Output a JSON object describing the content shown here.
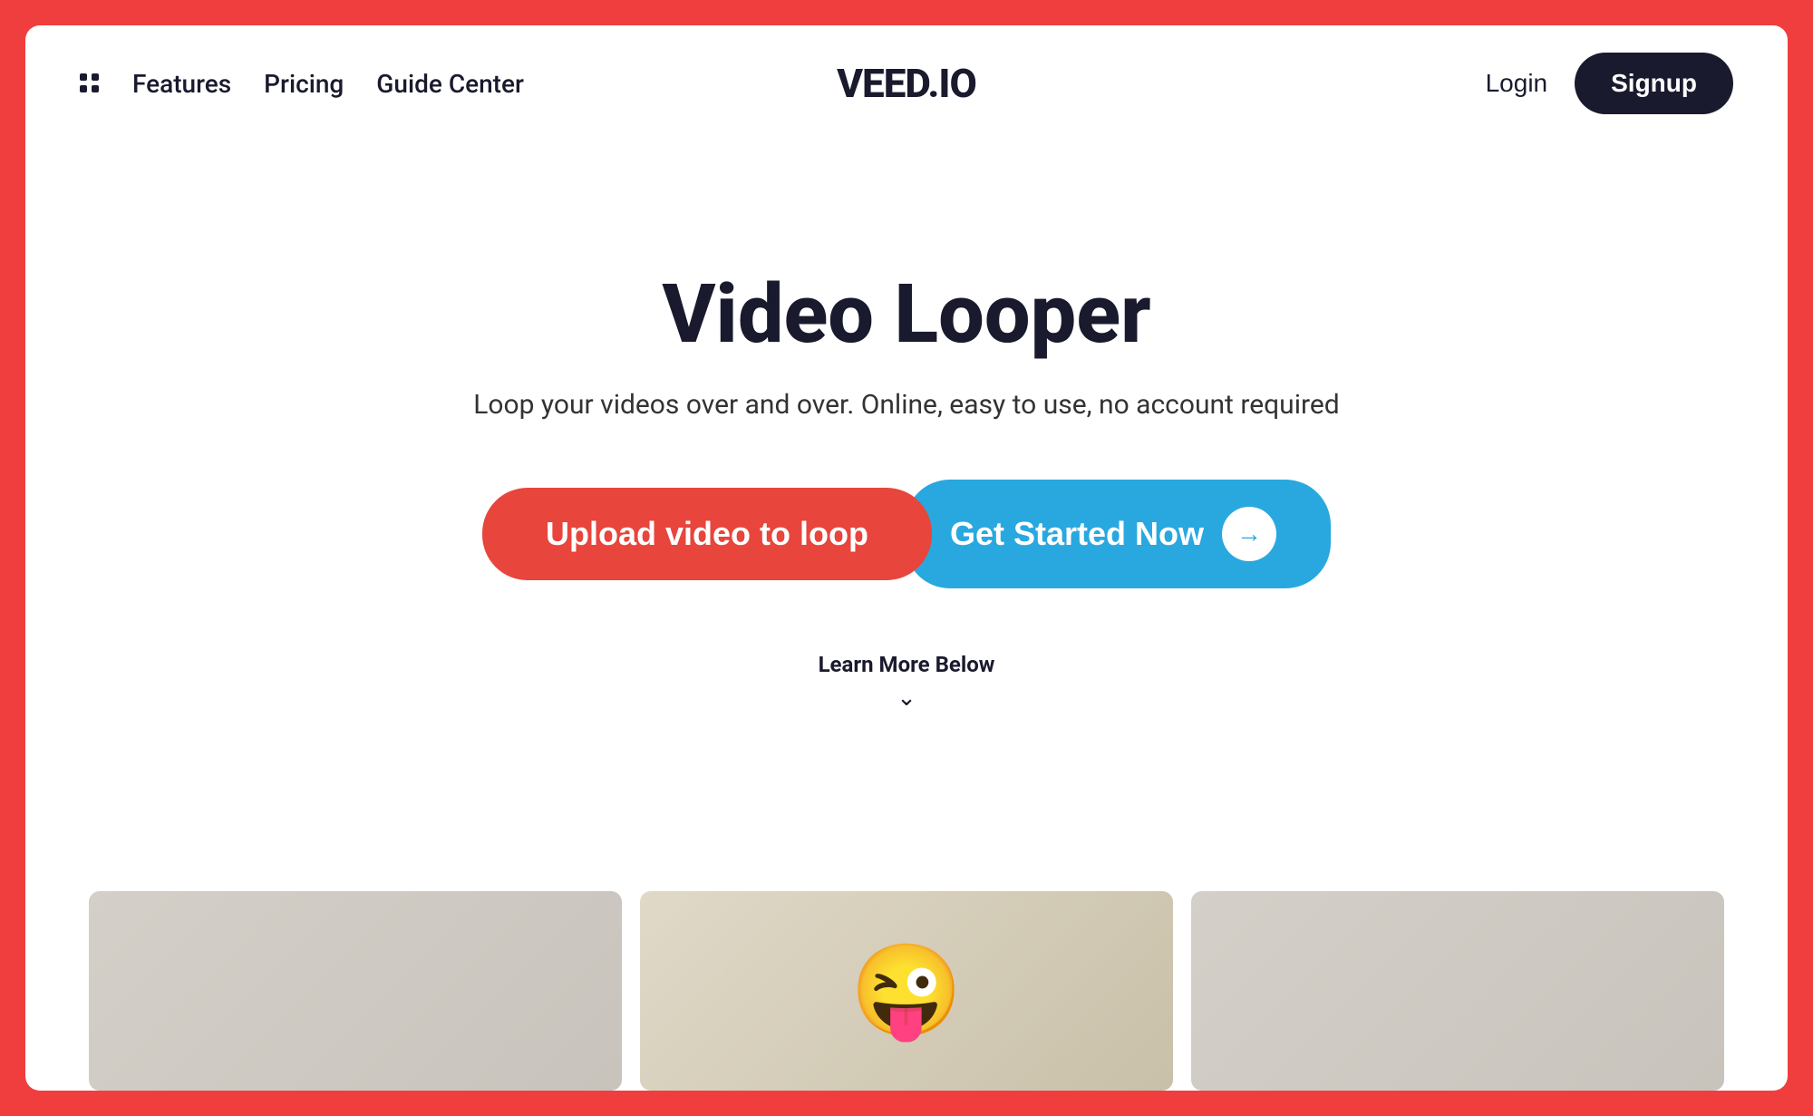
{
  "colors": {
    "outer_bg": "#f03e3e",
    "inner_bg": "#ffffff",
    "dark": "#1a1a2e",
    "red_btn": "#e8453c",
    "blue_btn": "#29a8e0"
  },
  "navbar": {
    "dots_icon": "grid-dots",
    "items": [
      {
        "label": "Features",
        "key": "features"
      },
      {
        "label": "Pricing",
        "key": "pricing"
      },
      {
        "label": "Guide Center",
        "key": "guide-center"
      }
    ],
    "logo": "VEED.IO",
    "login_label": "Login",
    "signup_label": "Signup"
  },
  "hero": {
    "title": "Video Looper",
    "subtitle": "Loop your videos over and over. Online, easy to use, no account required",
    "upload_btn_label": "Upload video to loop",
    "get_started_label": "Get Started Now",
    "learn_more_label": "Learn More Below",
    "arrow_icon": "→"
  },
  "thumbnails": [
    {
      "id": "left",
      "content": ""
    },
    {
      "id": "center",
      "content": "😜"
    },
    {
      "id": "right",
      "content": ""
    }
  ]
}
